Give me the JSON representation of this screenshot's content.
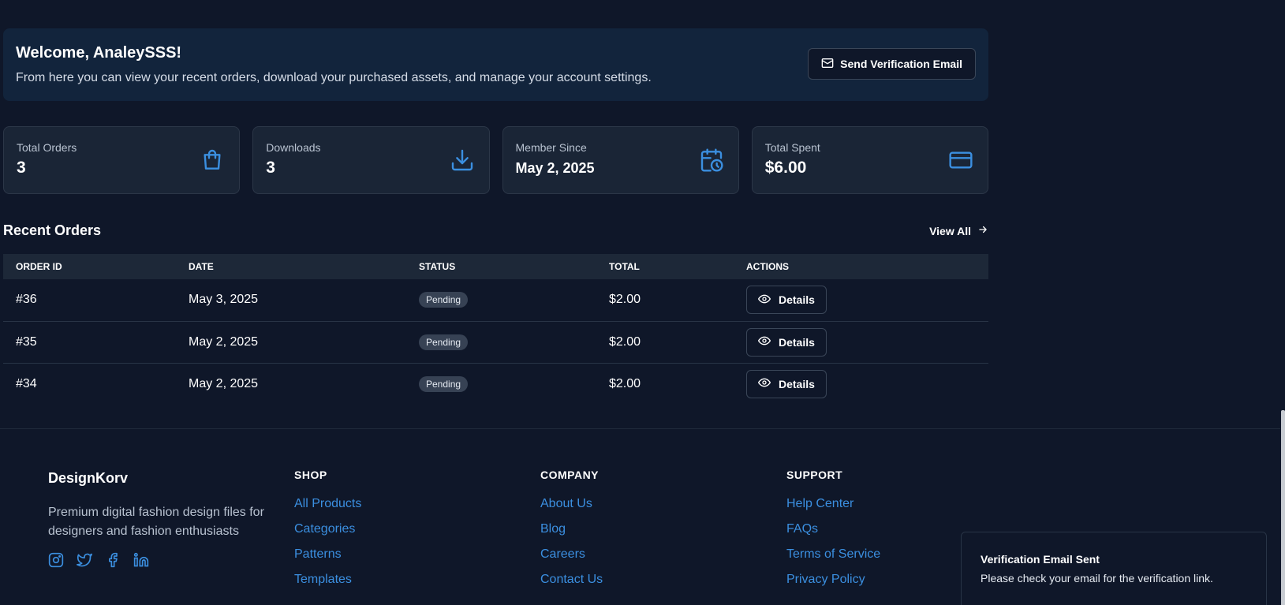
{
  "welcome": {
    "title": "Welcome, AnaleySSS!",
    "subtitle": "From here you can view your recent orders, download your purchased assets, and manage your account settings.",
    "verify_button": "Send Verification Email"
  },
  "stats": [
    {
      "label": "Total Orders",
      "value": "3",
      "icon": "shopping-bag-icon"
    },
    {
      "label": "Downloads",
      "value": "3",
      "icon": "download-icon"
    },
    {
      "label": "Member Since",
      "value": "May 2, 2025",
      "icon": "calendar-clock-icon"
    },
    {
      "label": "Total Spent",
      "value": "$6.00",
      "icon": "credit-card-icon"
    }
  ],
  "recent_orders": {
    "title": "Recent Orders",
    "view_all": "View All",
    "columns": [
      "ORDER ID",
      "DATE",
      "STATUS",
      "TOTAL",
      "ACTIONS"
    ],
    "rows": [
      {
        "id": "#36",
        "date": "May 3, 2025",
        "status": "Pending",
        "total": "$2.00",
        "action": "Details"
      },
      {
        "id": "#35",
        "date": "May 2, 2025",
        "status": "Pending",
        "total": "$2.00",
        "action": "Details"
      },
      {
        "id": "#34",
        "date": "May 2, 2025",
        "status": "Pending",
        "total": "$2.00",
        "action": "Details"
      }
    ]
  },
  "footer": {
    "brand": "DesignKorv",
    "tagline": "Premium digital fashion design files for designers and fashion enthusiasts",
    "socials": [
      "instagram-icon",
      "twitter-icon",
      "facebook-icon",
      "linkedin-icon"
    ],
    "shop": {
      "heading": "SHOP",
      "links": [
        "All Products",
        "Categories",
        "Patterns",
        "Templates"
      ]
    },
    "company": {
      "heading": "COMPANY",
      "links": [
        "About Us",
        "Blog",
        "Careers",
        "Contact Us"
      ]
    },
    "support": {
      "heading": "SUPPORT",
      "links": [
        "Help Center",
        "FAQs",
        "Terms of Service",
        "Privacy Policy"
      ]
    }
  },
  "toast": {
    "title": "Verification Email Sent",
    "message": "Please check your email for the verification link."
  },
  "colors": {
    "accent": "#3b8fe0",
    "background": "#0f1729",
    "card": "#1a2536"
  }
}
